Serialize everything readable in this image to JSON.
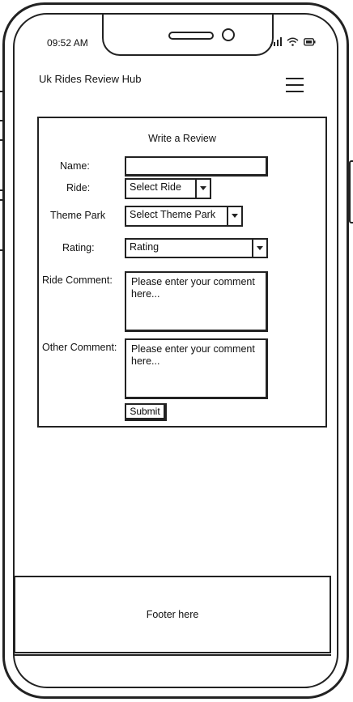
{
  "status_bar": {
    "time": "09:52 AM",
    "icons": [
      "signal-icon",
      "wifi-icon",
      "battery-icon"
    ]
  },
  "header": {
    "title": "Uk Rides Review Hub",
    "menu_icon": "hamburger-menu-icon"
  },
  "form": {
    "heading": "Write a Review",
    "name_label": "Name:",
    "name_value": "",
    "ride_label": "Ride:",
    "ride_select": "Select Ride",
    "park_label": "Theme Park",
    "park_select": "Select Theme Park",
    "rating_label": "Rating:",
    "rating_select": "Rating",
    "ride_comment_label": "Ride Comment:",
    "ride_comment_placeholder": "Please enter your comment here...",
    "other_comment_label": "Other Comment:",
    "other_comment_placeholder": "Please enter your comment here...",
    "submit_label": "Submit"
  },
  "footer": {
    "text": "Footer here"
  }
}
